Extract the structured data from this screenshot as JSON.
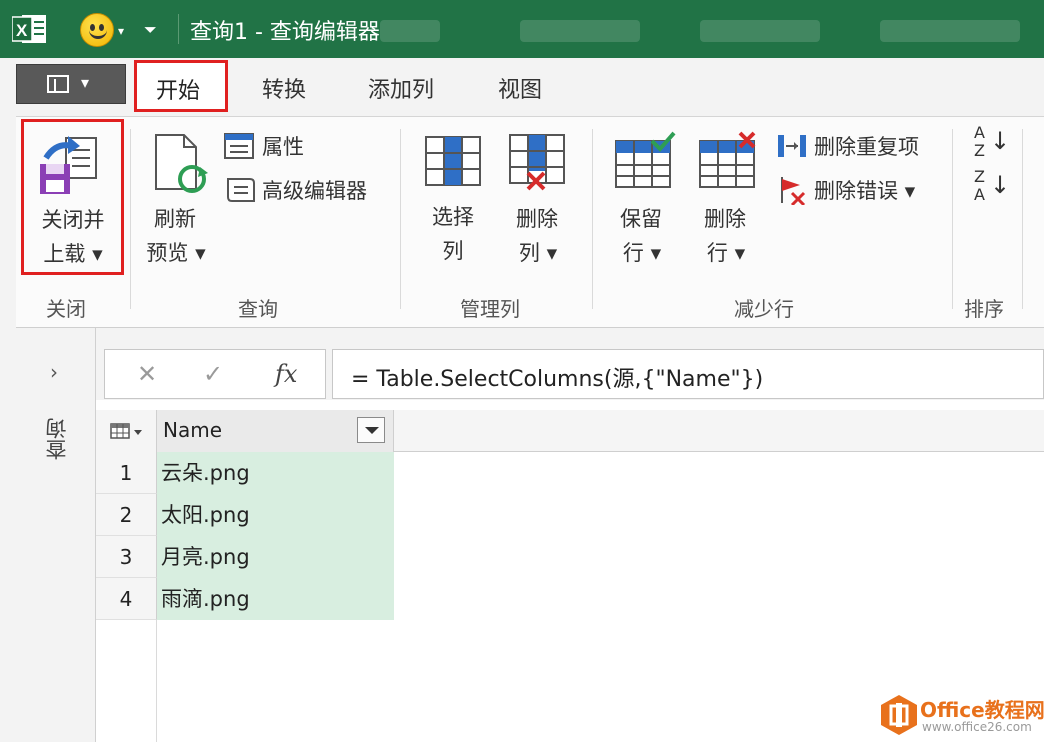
{
  "window": {
    "title": "查询1 - 查询编辑器",
    "app_icon": "excel-icon",
    "brand_color": "#217346"
  },
  "tabs": {
    "file_menu_icon": "document-icon",
    "items": [
      "开始",
      "转换",
      "添加列",
      "视图"
    ],
    "active": "开始",
    "highlight_color": "#e02020"
  },
  "ribbon": {
    "groups": {
      "close": {
        "label": "关闭",
        "close_load": {
          "line1": "关闭并",
          "line2": "上载 ▾"
        }
      },
      "query": {
        "label": "查询",
        "refresh": {
          "line1": "刷新",
          "line2": "预览 ▾"
        },
        "properties": "属性",
        "advanced_editor": "高级编辑器"
      },
      "manage_columns": {
        "label": "管理列",
        "choose": {
          "line1": "选择",
          "line2": "列"
        },
        "remove": {
          "line1": "删除",
          "line2": "列 ▾"
        }
      },
      "reduce_rows": {
        "label": "减少行",
        "keep": {
          "line1": "保留",
          "line2": "行 ▾"
        },
        "remove": {
          "line1": "删除",
          "line2": "行 ▾"
        },
        "remove_duplicates": "删除重复项",
        "remove_errors": "删除错误 ▾"
      },
      "sort": {
        "label": "排序",
        "asc": {
          "top": "A",
          "bottom": "Z"
        },
        "desc": {
          "top": "Z",
          "bottom": "A"
        }
      }
    }
  },
  "left_pane": {
    "expand_glyph": "›",
    "label": "查询"
  },
  "formula_bar": {
    "cancel": "✕",
    "confirm": "✓",
    "fx": "fx",
    "formula": "= Table.SelectColumns(源,{\"Name\"})"
  },
  "table": {
    "column": "Name",
    "rows": [
      {
        "num": "1",
        "value": "云朵.png"
      },
      {
        "num": "2",
        "value": "太阳.png"
      },
      {
        "num": "3",
        "value": "月亮.png"
      },
      {
        "num": "4",
        "value": "雨滴.png"
      }
    ],
    "selection_color": "#d8eee0"
  },
  "watermark": {
    "line1": "Office教程网",
    "line2": "www.office26.com"
  }
}
